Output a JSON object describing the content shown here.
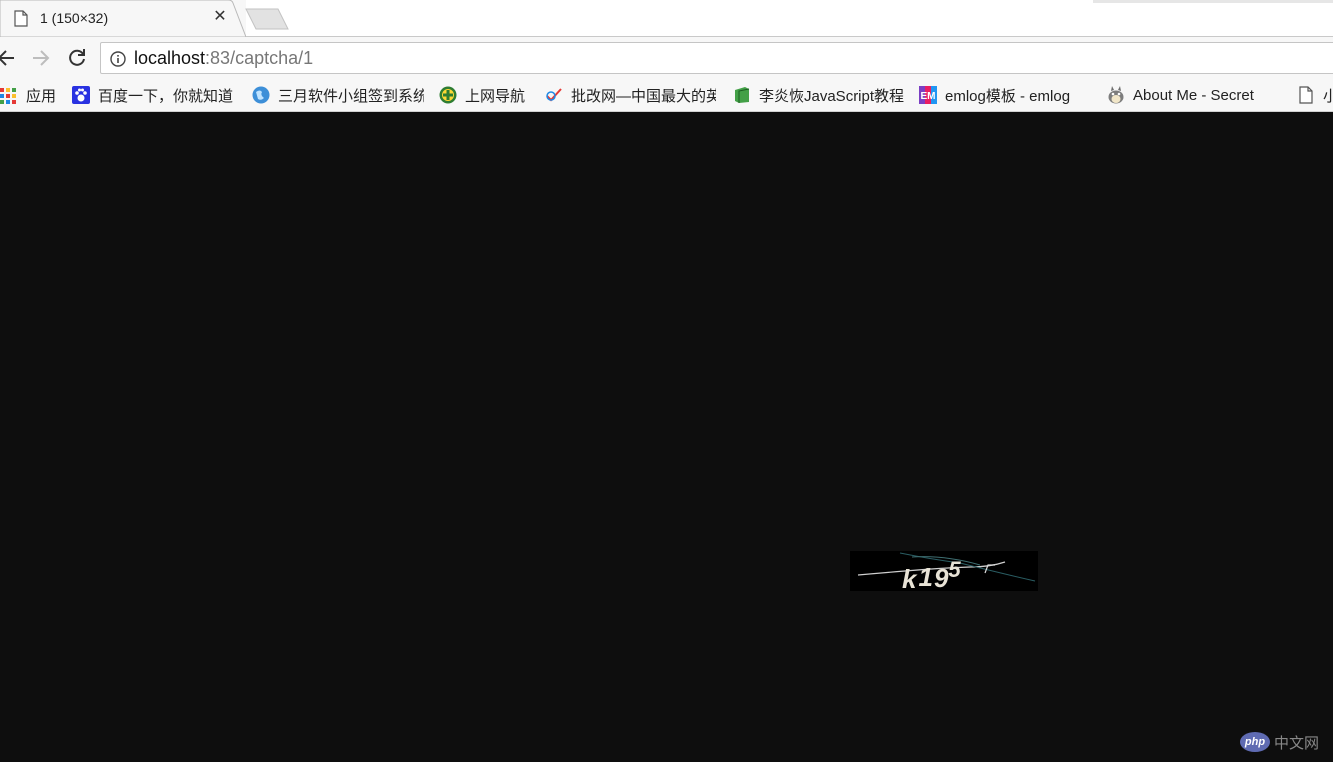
{
  "tab": {
    "title": "1 (150×32)",
    "close_glyph": "✕",
    "favicon": "page-icon"
  },
  "toolbar": {
    "back": "back-arrow-icon",
    "forward": "forward-arrow-icon",
    "reload": "reload-icon",
    "url_host": "localhost",
    "url_rest": ":83/captcha/1"
  },
  "bookmarks": [
    {
      "label": "应用",
      "icon": "apps-grid-icon"
    },
    {
      "label": "百度一下，你就知道",
      "icon": "baidu-paw-icon"
    },
    {
      "label": "三月软件小组签到系统",
      "icon": "globe-icon"
    },
    {
      "label": "上网导航",
      "icon": "plus-circle-icon"
    },
    {
      "label": "批改网—中国最大的英",
      "icon": "pen-check-icon"
    },
    {
      "label": "李炎恢JavaScript教程",
      "icon": "green-book-icon"
    },
    {
      "label": "emlog模板 - emlog",
      "icon": "em-logo-icon"
    },
    {
      "label": "About Me - Secret",
      "icon": "totoro-icon"
    },
    {
      "label": "小",
      "icon": "page-icon"
    }
  ],
  "captcha": {
    "text": "k195"
  },
  "watermark": {
    "logo": "php",
    "text": "中文网"
  },
  "colors": {
    "page_bg": "#0e0e0e",
    "chrome_bg": "#f7f7f7",
    "tab_bg": "#f7f7f7",
    "captcha_glyph": "#e8e3d6"
  }
}
